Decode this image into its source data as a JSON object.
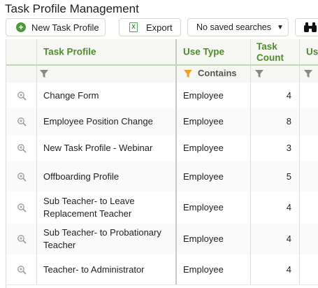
{
  "page": {
    "title": "Task Profile Management"
  },
  "toolbar": {
    "new_label": "New Task Profile",
    "export_label": "Export",
    "saved_searches": "No saved searches"
  },
  "grid": {
    "columns": [
      "Task Profile",
      "Use Type",
      "Task Count",
      "Use"
    ],
    "filter": {
      "use_type": "Contains"
    },
    "rows": [
      {
        "profile": "Change Form",
        "use_type": "Employee",
        "count": "4"
      },
      {
        "profile": "Employee Position Change",
        "use_type": "Employee",
        "count": "8"
      },
      {
        "profile": "New Task Profile - Webinar",
        "use_type": "Employee",
        "count": "3"
      },
      {
        "profile": "Offboarding Profile",
        "use_type": "Employee",
        "count": "5"
      },
      {
        "profile": "Sub Teacher- to Leave Replacement Teacher",
        "use_type": "Employee",
        "count": "4"
      },
      {
        "profile": "Sub Teacher- to Probationary Teacher",
        "use_type": "Employee",
        "count": "4"
      },
      {
        "profile": "Teacher- to Administrator",
        "use_type": "Employee",
        "count": "4"
      }
    ]
  },
  "colors": {
    "header_text": "#4f8c2e",
    "header_rule": "#c4d9b3",
    "active_filter": "#f0a020"
  },
  "icons": [
    "plus-circle-icon",
    "excel-icon",
    "chevron-down-icon",
    "binoculars-icon",
    "filter-icon",
    "zoom-icon"
  ]
}
